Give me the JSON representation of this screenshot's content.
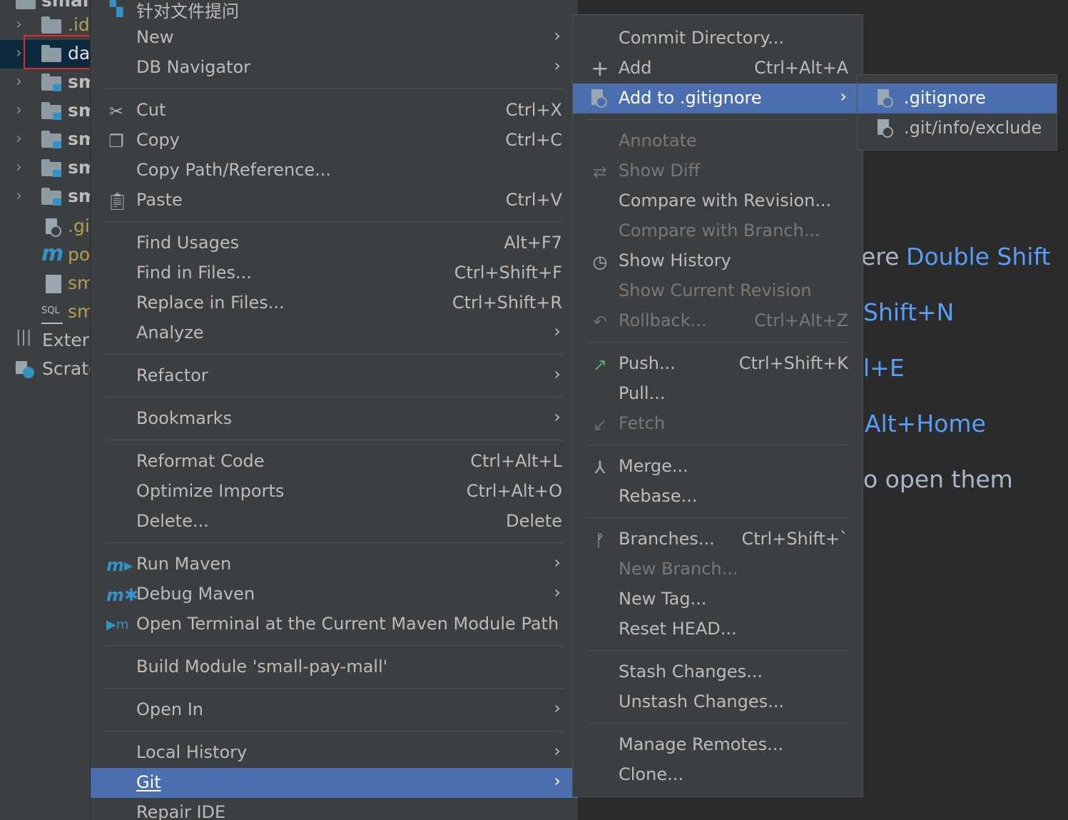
{
  "tree": {
    "items": [
      {
        "label": "small",
        "chev": ""
      },
      {
        "label": ".idea",
        "chev": "›"
      },
      {
        "label": "data",
        "chev": "›"
      },
      {
        "label": "sm",
        "chev": "›"
      },
      {
        "label": "sm",
        "chev": "›"
      },
      {
        "label": "sm",
        "chev": "›"
      },
      {
        "label": "sm",
        "chev": "›"
      },
      {
        "label": "sm",
        "chev": "›"
      },
      {
        "label": ".gi",
        "chev": ""
      },
      {
        "label": "po",
        "chev": ""
      },
      {
        "label": "sm",
        "chev": ""
      },
      {
        "label": "sm",
        "chev": ""
      },
      {
        "label": "Extern",
        "chev": ""
      },
      {
        "label": "Scratc",
        "chev": ""
      }
    ],
    "highlight_color": "#e32626"
  },
  "menu1": {
    "top_item": "针对文件提问",
    "items": {
      "new": "New",
      "db_navigator": "DB Navigator",
      "cut": "Cut",
      "cut_sc": "Ctrl+X",
      "copy": "Copy",
      "copy_sc": "Ctrl+C",
      "copy_path": "Copy Path/Reference...",
      "paste": "Paste",
      "paste_sc": "Ctrl+V",
      "find_usages": "Find Usages",
      "find_usages_sc": "Alt+F7",
      "find_in_files": "Find in Files...",
      "find_in_files_sc": "Ctrl+Shift+F",
      "replace_in_files": "Replace in Files...",
      "replace_in_files_sc": "Ctrl+Shift+R",
      "analyze": "Analyze",
      "refactor": "Refactor",
      "bookmarks": "Bookmarks",
      "reformat": "Reformat Code",
      "reformat_sc": "Ctrl+Alt+L",
      "optimize": "Optimize Imports",
      "optimize_sc": "Ctrl+Alt+O",
      "delete": "Delete...",
      "delete_sc": "Delete",
      "run_maven": "Run Maven",
      "debug_maven": "Debug Maven",
      "open_terminal": "Open Terminal at the Current Maven Module Path",
      "build_module": "Build Module 'small-pay-mall'",
      "open_in": "Open In",
      "local_history": "Local History",
      "git": "Git",
      "repair_ide": "Repair IDE"
    }
  },
  "menu2": {
    "commit_dir": "Commit Directory...",
    "add": "Add",
    "add_sc": "Ctrl+Alt+A",
    "add_gitignore": "Add to .gitignore",
    "annotate": "Annotate",
    "show_diff": "Show Diff",
    "compare_revision": "Compare with Revision...",
    "compare_branch": "Compare with Branch...",
    "show_history": "Show History",
    "show_current_rev": "Show Current Revision",
    "rollback": "Rollback...",
    "rollback_sc": "Ctrl+Alt+Z",
    "push": "Push...",
    "push_sc": "Ctrl+Shift+K",
    "pull": "Pull...",
    "fetch": "Fetch",
    "merge": "Merge...",
    "rebase": "Rebase...",
    "branches": "Branches...",
    "branches_sc": "Ctrl+Shift+`",
    "new_branch": "New Branch...",
    "new_tag": "New Tag...",
    "reset_head": "Reset HEAD...",
    "stash": "Stash Changes...",
    "unstash": "Unstash Changes...",
    "manage_remotes": "Manage Remotes...",
    "clone": "Clone..."
  },
  "menu3": {
    "gitignore": ".gitignore",
    "exclude": ".git/info/exclude"
  },
  "background_hints": {
    "search_everywhere_prefix": "ere",
    "search_everywhere_key": "Double Shift",
    "goto_file_key": "Shift+N",
    "recent_files_key": "l+E",
    "nav_bar_key": "Alt+Home",
    "drop_files": "o open them"
  },
  "colors": {
    "menu_bg": "#3c3f41",
    "selection": "#4b6eaf",
    "link_blue": "#589df6"
  }
}
